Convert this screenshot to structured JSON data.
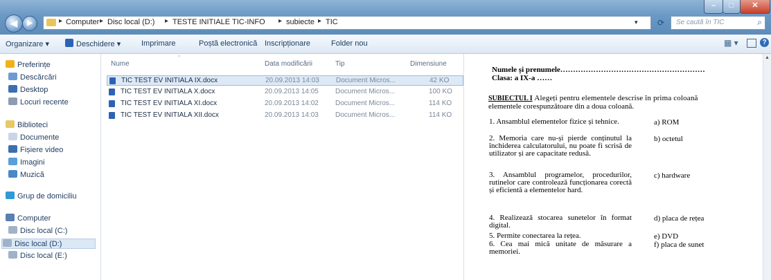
{
  "window": {
    "nav": {
      "back": "◀",
      "forward": "▶"
    },
    "breadcrumb": [
      "Computer",
      "Disc local (D:)",
      "TESTE INITIALE TIC-INFO",
      "subiecte",
      "TIC"
    ],
    "search_placeholder": "Se caută în TIC"
  },
  "toolbar": {
    "items": [
      "Organizare ▾",
      "Deschidere ▾",
      "Imprimare",
      "Poștă electronică",
      "Inscripționare",
      "Folder nou"
    ]
  },
  "sidebar": {
    "items": [
      {
        "label": "Preferințe",
        "icon": "star-icon",
        "color": "#f0b21c"
      },
      {
        "label": "Descărcări",
        "icon": "download-folder-icon",
        "color": "#6d9ad2"
      },
      {
        "label": "Desktop",
        "icon": "desktop-icon",
        "color": "#3b6fb0"
      },
      {
        "label": "Locuri recente",
        "icon": "recent-places-icon",
        "color": "#8c9db2"
      },
      {
        "label": "Biblioteci",
        "icon": "libraries-icon",
        "color": "#e8c866"
      },
      {
        "label": "Documente",
        "icon": "documents-icon",
        "color": "#c9d6e6"
      },
      {
        "label": "Fișiere video",
        "icon": "video-icon",
        "color": "#3b6fb0"
      },
      {
        "label": "Imagini",
        "icon": "pictures-icon",
        "color": "#5aa0d8"
      },
      {
        "label": "Muzică",
        "icon": "music-icon",
        "color": "#4b87c9"
      },
      {
        "label": "Grup de domiciliu",
        "icon": "homegroup-icon",
        "color": "#2f9ad6"
      },
      {
        "label": "Computer",
        "icon": "computer-icon",
        "color": "#5a7fb0"
      },
      {
        "label": "Disc local (C:)",
        "icon": "drive-c-icon",
        "color": "#9fb2c8"
      },
      {
        "label": "Disc local (D:)",
        "icon": "drive-d-icon",
        "color": "#9fb2c8"
      },
      {
        "label": "Disc local (E:)",
        "icon": "drive-e-icon",
        "color": "#9fb2c8"
      }
    ]
  },
  "columns": [
    "Nume",
    "Data modificării",
    "Tip",
    "Dimensiune"
  ],
  "files": [
    {
      "name": "TIC TEST EV INITIALA IX.docx",
      "date": "20.09.2013 14:03",
      "type": "Document Micros...",
      "size": "42 KO"
    },
    {
      "name": "TIC TEST EV INITIALA X.docx",
      "date": "20.09.2013 14:05",
      "type": "Document Micros...",
      "size": "100 KO"
    },
    {
      "name": "TIC TEST EV INITIALA XI.docx",
      "date": "20.09.2013 14:02",
      "type": "Document Micros...",
      "size": "114 KO"
    },
    {
      "name": "TIC TEST EV INITIALA XII.docx",
      "date": "20.09.2013 14:03",
      "type": "Document Micros...",
      "size": "114 KO"
    }
  ],
  "preview": {
    "name_line": "Numele și prenumele…………………………………………………",
    "class_line": "Clasa: a IX-a ……",
    "subject_label": "SUBIECTUL I",
    "subject_text_1": "Alegeți pentru elementele descrise în prima coloană",
    "subject_text_2": "elementele corespunzătoare din a doua coloană.",
    "items": [
      "1.   Ansamblul elementelor fizice și tehnice.",
      "2.   Memoria care nu-și pierde conținutul la închiderea calculatorului, nu poate fi scrisă de utilizator și are capacitate redusă.",
      "3.   Ansamblul programelor, procedurilor, rutinelor care controlează funcționarea corectă și eficientă a elementelor hard.",
      "4.   Realizează stocarea sunetelor în format digital.",
      "5.   Permite conectarea la rețea.",
      "6.   Cea mai mică unitate de măsurare a memoriei."
    ],
    "options": [
      "a)   ROM",
      "b)   octetul",
      "c)   hardware",
      "d)   placa de rețea",
      "e)   DVD",
      "f)   placa de sunet"
    ]
  },
  "colors": {
    "accent": "#2d6cb5",
    "selection": "#dde9f6"
  }
}
